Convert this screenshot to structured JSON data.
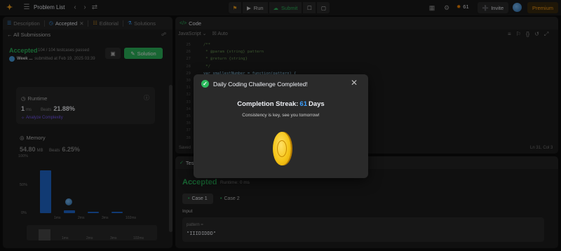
{
  "topnav": {
    "problem_list": "Problem List",
    "run": "Run",
    "submit": "Submit",
    "streak": "61",
    "invite": "Invite",
    "premium": "Premium"
  },
  "left": {
    "tabs": [
      {
        "label": "Description",
        "icon": "doc-icon"
      },
      {
        "label": "Accepted",
        "icon": "clock-icon"
      },
      {
        "label": "Editorial",
        "icon": "book-icon"
      },
      {
        "label": "Solutions",
        "icon": "flask-icon"
      }
    ],
    "all_submissions": "All Submissions",
    "status": "Accepted",
    "passed": "104 / 104 testcases passed",
    "user": "Week ...",
    "submitted": "submitted at Feb 19, 2025 03:39",
    "solution_button": "Solution",
    "runtime": {
      "label": "Runtime",
      "value": "1",
      "unit": "ms",
      "beats_label": "Beats",
      "beats_value": "21.88%",
      "analyze": "Analyze Complexity"
    },
    "memory": {
      "label": "Memory",
      "value": "54.80",
      "unit": "MB",
      "beats_label": "Beats",
      "beats_value": "6.25%"
    },
    "chart": {
      "y_ticks": [
        "100%",
        "50%",
        "0%"
      ],
      "x_ticks": [
        "1ms",
        "2ms",
        "3ms",
        "102ms"
      ],
      "mini_ticks": [
        "1ms",
        "2ms",
        "3ms",
        "102ms"
      ]
    }
  },
  "code": {
    "title": "Code",
    "language": "JavaScript",
    "auto": "Auto",
    "line_numbers": [
      "25",
      "26",
      "27",
      "28",
      "29",
      "30",
      "31",
      "32",
      "33",
      "34",
      "35",
      "36",
      "37",
      "38"
    ],
    "lines": [
      "/**",
      " * @param {string} pattern",
      " * @return {string}",
      " */",
      "var smallestNumber = function(pattern) {"
    ],
    "saved": "Saved",
    "position": "Ln 31, Col 3"
  },
  "test": {
    "tab": "Test Result",
    "status": "Accepted",
    "runtime": "Runtime: 0 ms",
    "cases": [
      "Case 1",
      "Case 2"
    ],
    "input_label": "Input",
    "param_name": "pattern =",
    "param_value": "\"IIIDIDDD\""
  },
  "modal": {
    "title": "Daily Coding Challenge Completed!",
    "streak_label": "Completion Streak:",
    "streak_value": "61",
    "streak_unit": "Days",
    "subtitle": "Consistency is key, see you tomorrow!"
  },
  "chart_data": {
    "type": "bar",
    "categories": [
      "1ms",
      "2ms",
      "3ms",
      "102ms"
    ],
    "values": [
      75,
      5,
      2,
      2
    ],
    "ylim": [
      0,
      100
    ],
    "highlight": "1ms"
  },
  "colors": {
    "accent_green": "#2cbb5d",
    "accent_orange": "#ffa116",
    "bar_blue": "#1f6bd1",
    "streak_blue": "#3b9eff"
  }
}
